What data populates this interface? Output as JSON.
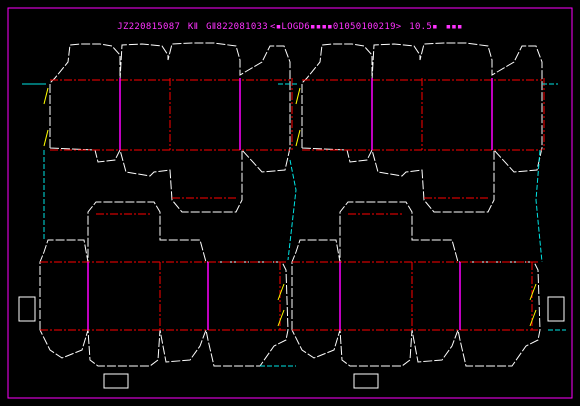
{
  "title": {
    "code": "JZ220815087",
    "model": "KⅡ",
    "part": "GⅡ822081033",
    "spec": "<▪LOGD6▪▪▪▪01050100219>",
    "size": "10.5▪",
    "mark": "▪▪▪"
  },
  "colors": {
    "background": "#000000",
    "border": "#ff00ff",
    "cut": "#ffffff",
    "crease": "#ff0000",
    "perforation": "#ff00ff",
    "bleed": "#00e5e5",
    "glue": "#ffff00",
    "title": "#ff33ff"
  }
}
